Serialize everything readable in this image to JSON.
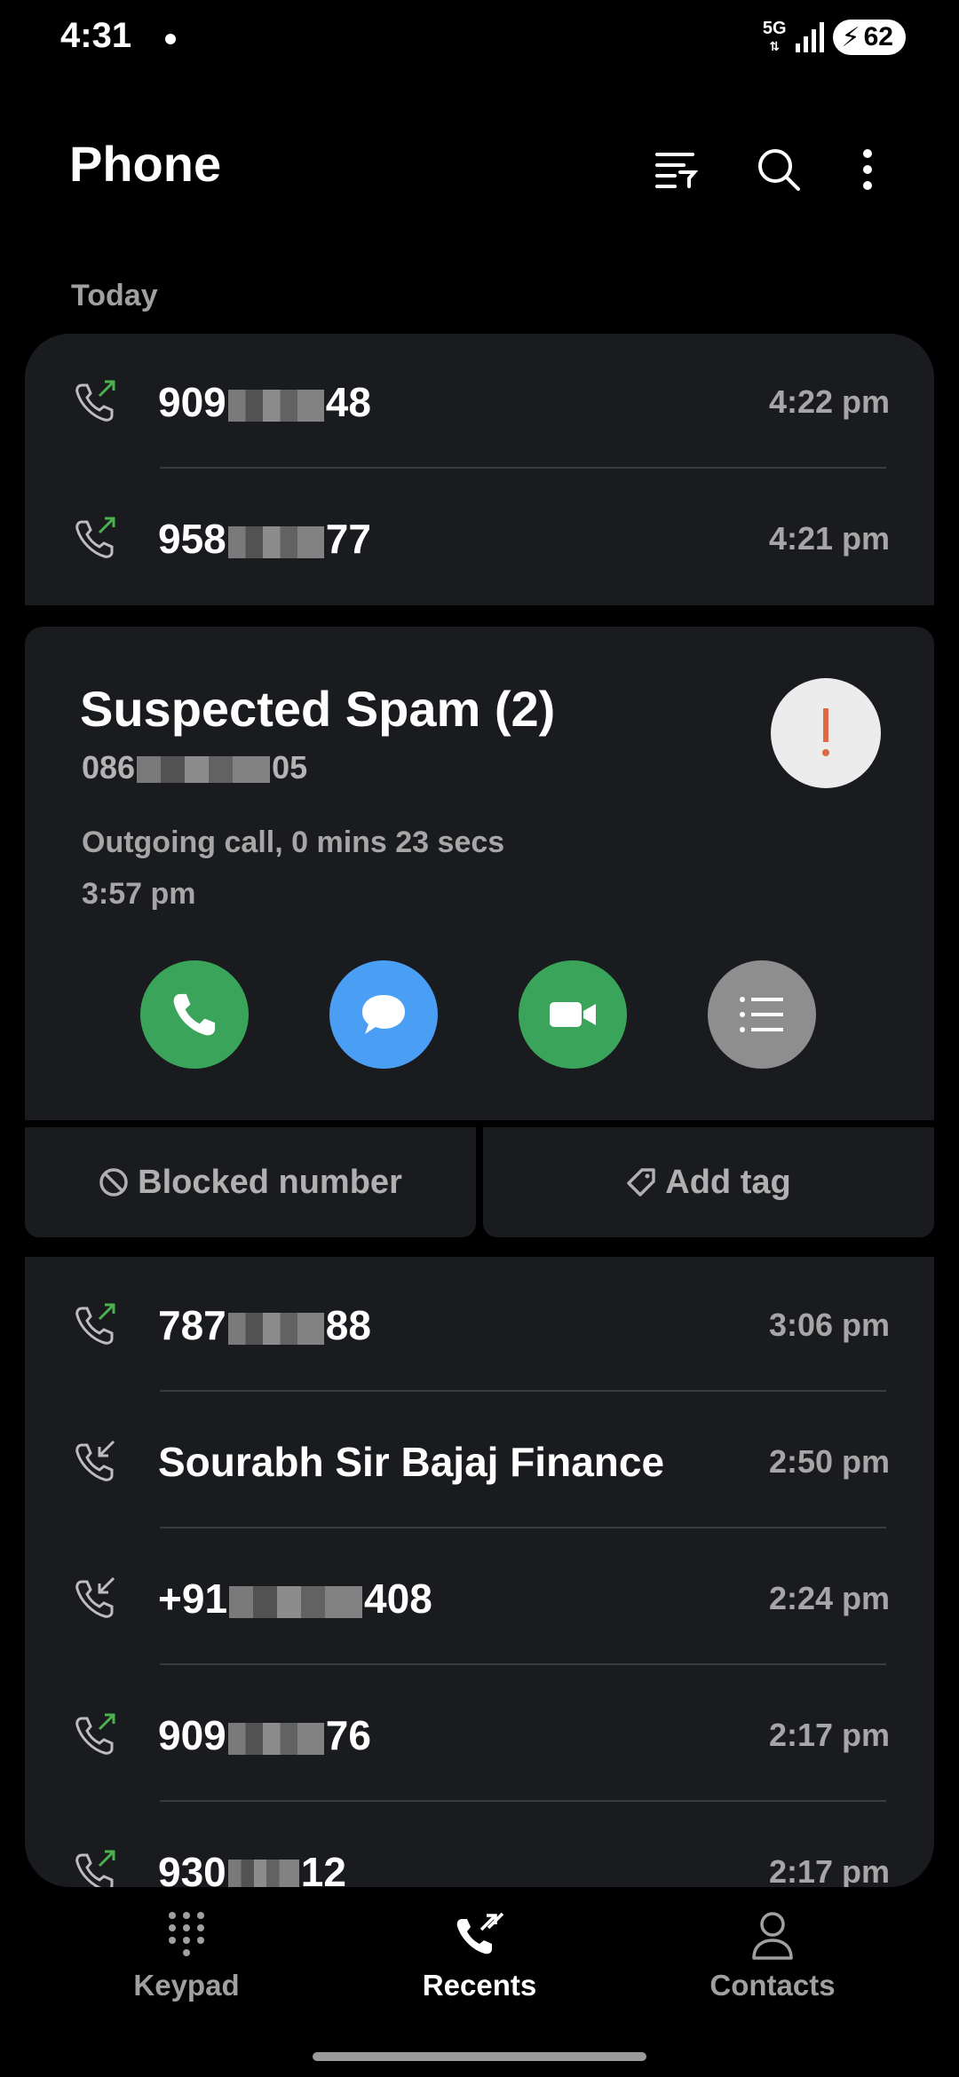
{
  "status_bar": {
    "time": "4:31",
    "network": "5G",
    "battery": "62"
  },
  "header": {
    "title": "Phone"
  },
  "section": {
    "today": "Today"
  },
  "calls_top": [
    {
      "prefix": "909",
      "suffix": "48",
      "time": "4:22 pm",
      "direction": "outgoing"
    },
    {
      "prefix": "958",
      "suffix": "77",
      "time": "4:21 pm",
      "direction": "outgoing"
    }
  ],
  "spam": {
    "title": "Suspected Spam (2)",
    "number_prefix": "086",
    "number_suffix": "05",
    "detail": "Outgoing call, 0 mins 23 secs",
    "time": "3:57 pm",
    "blocked_label": "Blocked number",
    "tag_label": "Add tag"
  },
  "calls_bottom": [
    {
      "prefix": "787",
      "suffix": "88",
      "time": "3:06 pm",
      "direction": "outgoing"
    },
    {
      "prefix": "Sourabh Sir Bajaj Finance",
      "suffix": "",
      "time": "2:50 pm",
      "direction": "incoming"
    },
    {
      "prefix": "+91",
      "suffix": "408",
      "time": "2:24 pm",
      "direction": "incoming"
    },
    {
      "prefix": "909",
      "suffix": "76",
      "time": "2:17 pm",
      "direction": "outgoing"
    },
    {
      "prefix": "930",
      "suffix": "12",
      "time": "2:17 pm",
      "direction": "outgoing"
    }
  ],
  "nav": {
    "keypad": "Keypad",
    "recents": "Recents",
    "contacts": "Contacts"
  },
  "colors": {
    "outgoing_arrow": "#4caf50",
    "green": "#3aa55a",
    "blue": "#4a9ff5",
    "gray": "#8e8e8e",
    "warn": "#e06a44"
  }
}
